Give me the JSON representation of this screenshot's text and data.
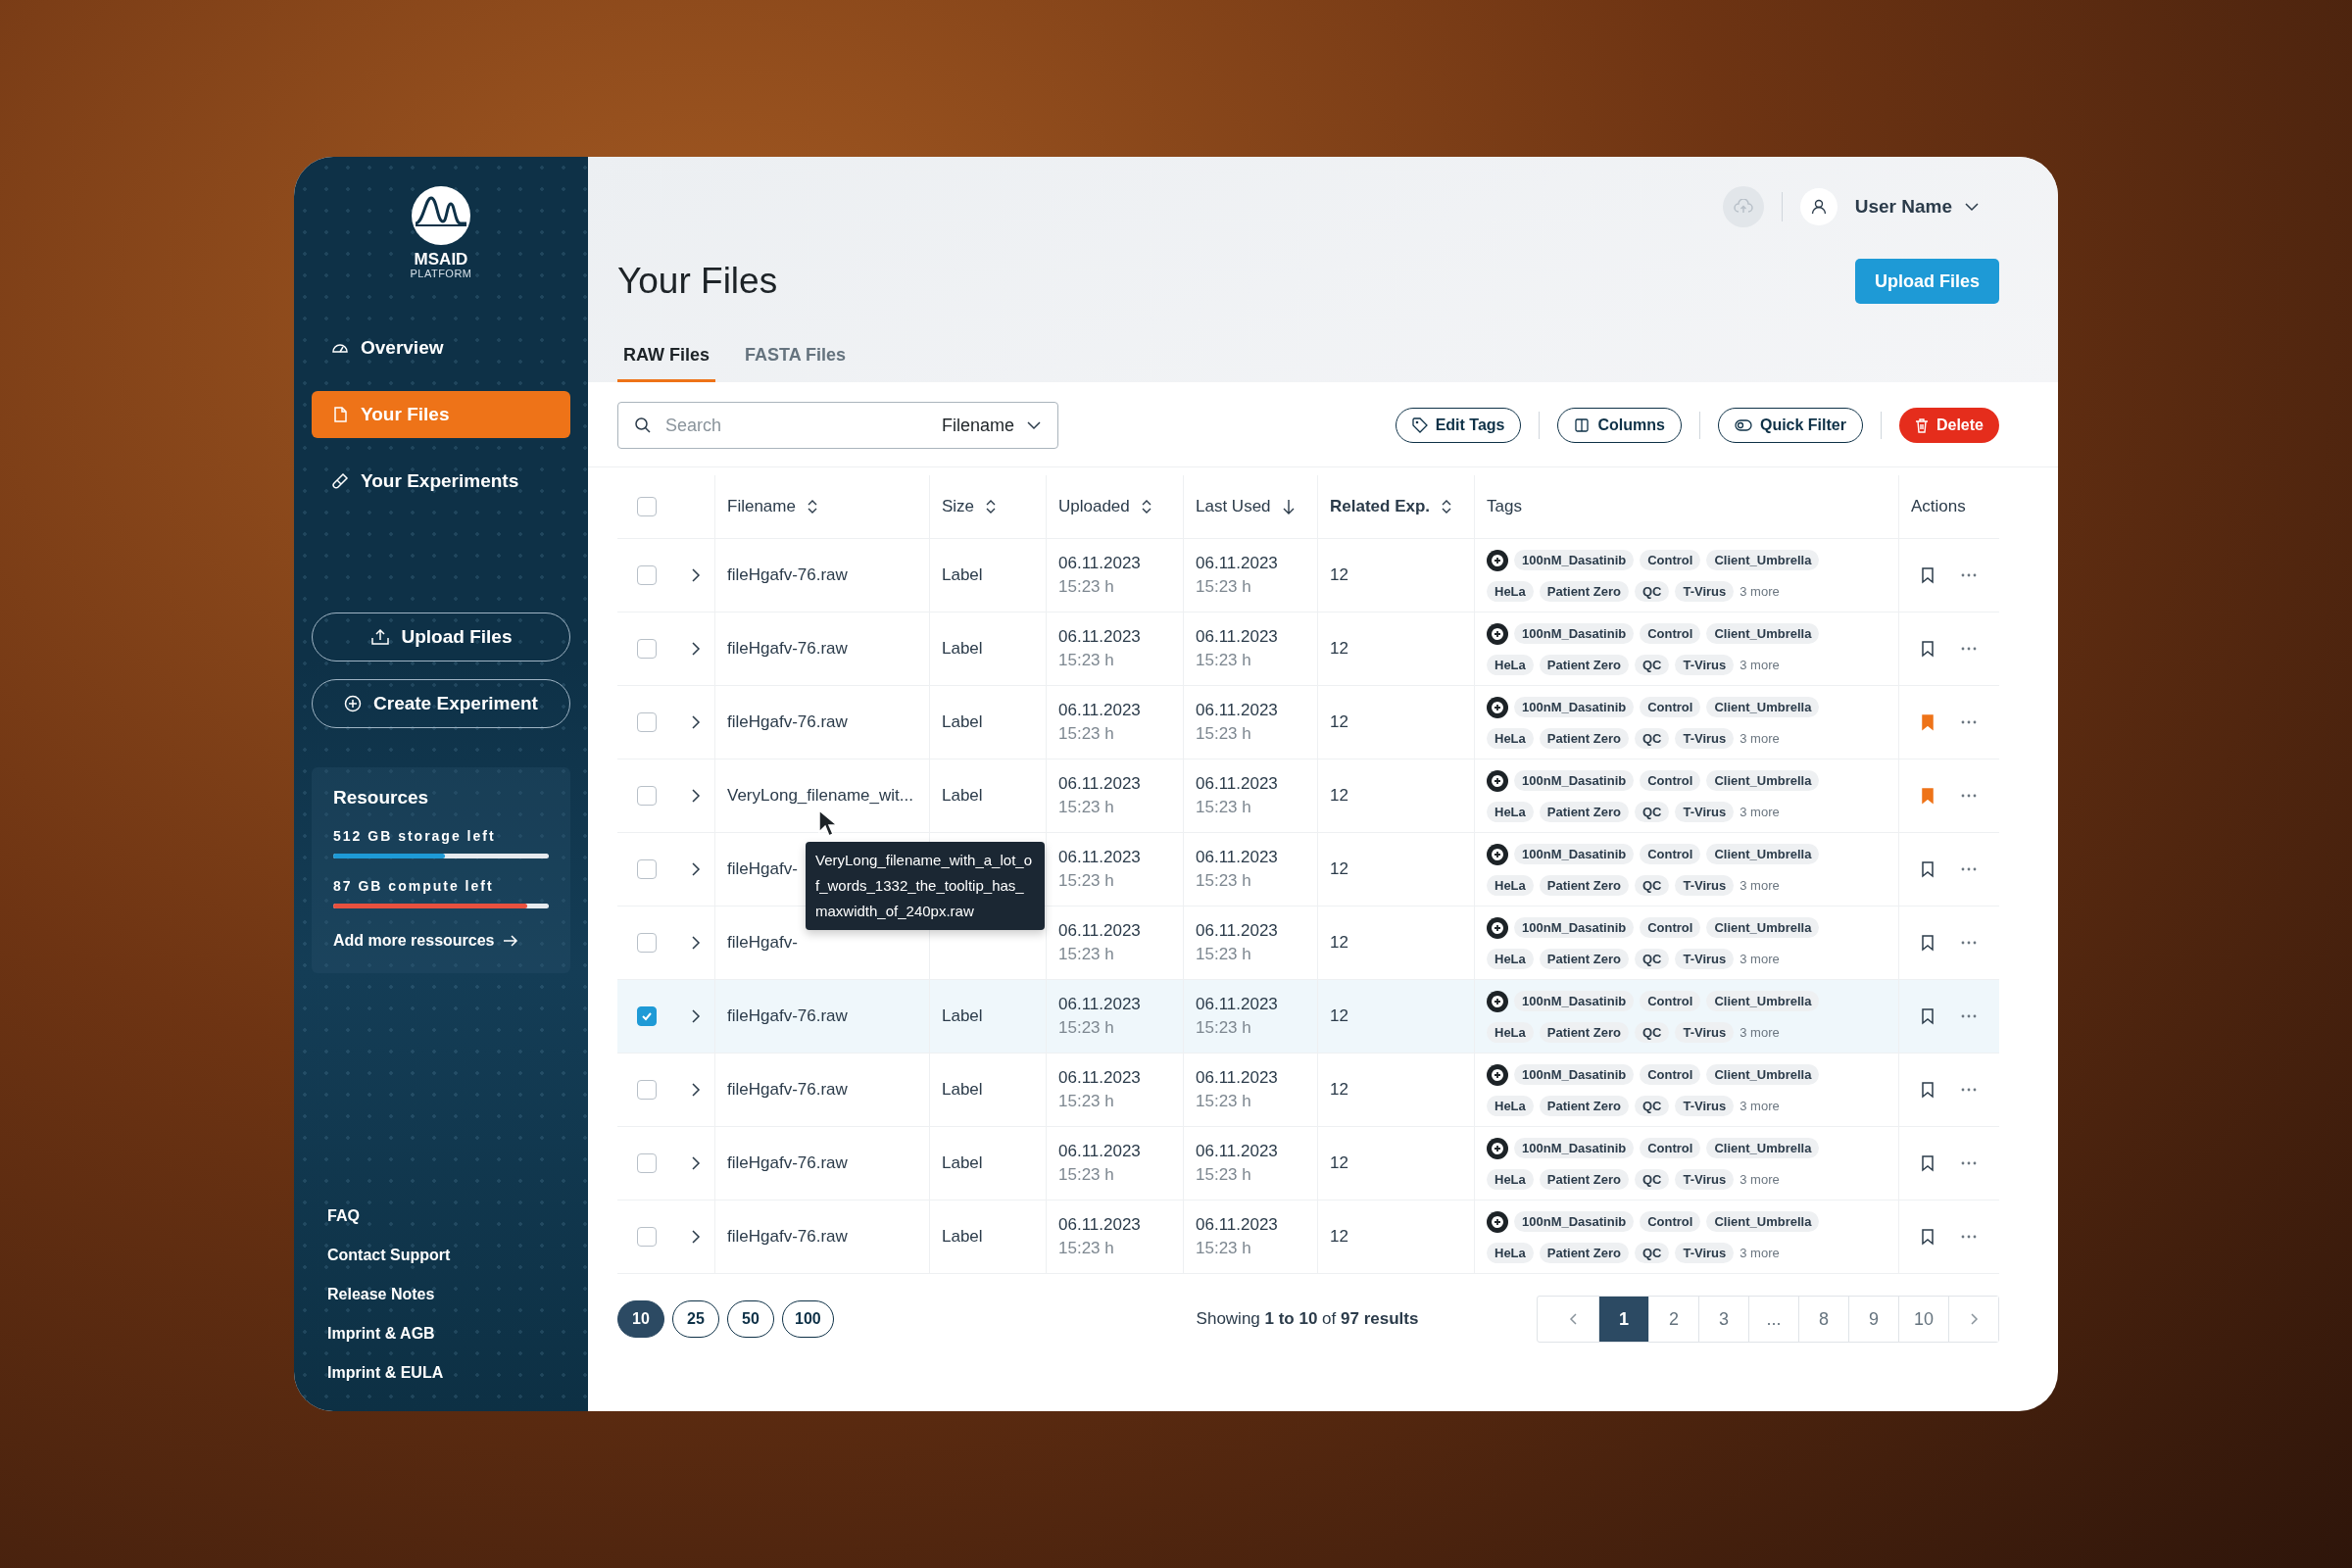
{
  "sidebar": {
    "brand": "MSAID",
    "brand_subtitle": "PLATFORM",
    "nav": [
      {
        "label": "Overview",
        "selected": false
      },
      {
        "label": "Your Files",
        "selected": true
      },
      {
        "label": "Your Experiments",
        "selected": false
      }
    ],
    "actions": [
      "Upload Files",
      "Create Experiment"
    ],
    "resources": {
      "title": "Resources",
      "meters": [
        {
          "label": "512 GB storage left",
          "level": 0.52,
          "color": "#1e9ad6"
        },
        {
          "label": "87 GB compute left",
          "level": 0.9,
          "color": "#e8513f"
        }
      ],
      "link": "Add more ressources"
    },
    "footer_links": [
      "FAQ",
      "Contact Support",
      "Release Notes",
      "Imprint & AGB",
      "Imprint & EULA"
    ]
  },
  "topbar": {
    "user_name": "User Name"
  },
  "page_title": "Your Files",
  "upload_button": "Upload Files",
  "tabs": [
    {
      "label": "RAW Files",
      "selected": true
    },
    {
      "label": "FASTA Files",
      "selected": false
    }
  ],
  "search": {
    "placeholder": "Search",
    "field": "Filename"
  },
  "toolbar": [
    {
      "label": "Edit Tags",
      "kind": "outline"
    },
    {
      "label": "Columns",
      "kind": "outline"
    },
    {
      "label": "Quick Filter",
      "kind": "outline"
    },
    {
      "label": "Delete",
      "kind": "danger"
    }
  ],
  "table": {
    "select_all_checked": false,
    "columns": [
      {
        "label": "Filename",
        "kind": "sortable",
        "bold": false
      },
      {
        "label": "Size",
        "kind": "sortable",
        "bold": false
      },
      {
        "label": "Uploaded",
        "kind": "sortable",
        "bold": false
      },
      {
        "label": "Last Used",
        "kind": "sorted",
        "bold": false
      },
      {
        "label": "Related Exp.",
        "kind": "sortable",
        "bold": true
      },
      {
        "label": "Tags",
        "kind": "plain",
        "bold": false
      },
      {
        "label": "Actions",
        "kind": "plain",
        "bold": false
      }
    ],
    "rows": [
      {
        "checked": false,
        "filename": "fileHgafv-76.raw",
        "size": "Label",
        "uploaded_date": "06.11.2023",
        "uploaded_time": "15:23 h",
        "last_used_date": "06.11.2023",
        "last_used_time": "15:23 h",
        "related": "12",
        "tags": [
          "100nM_Dasatinib",
          "Control",
          "Client_Umbrella",
          "HeLa",
          "Patient Zero",
          "QC",
          "T-Virus"
        ],
        "more": "3 more",
        "bookmarked": false
      },
      {
        "checked": false,
        "filename": "fileHgafv-76.raw",
        "size": "Label",
        "uploaded_date": "06.11.2023",
        "uploaded_time": "15:23 h",
        "last_used_date": "06.11.2023",
        "last_used_time": "15:23 h",
        "related": "12",
        "tags": [
          "100nM_Dasatinib",
          "Control",
          "Client_Umbrella",
          "HeLa",
          "Patient Zero",
          "QC",
          "T-Virus"
        ],
        "more": "3 more",
        "bookmarked": false
      },
      {
        "checked": false,
        "filename": "fileHgafv-76.raw",
        "size": "Label",
        "uploaded_date": "06.11.2023",
        "uploaded_time": "15:23 h",
        "last_used_date": "06.11.2023",
        "last_used_time": "15:23 h",
        "related": "12",
        "tags": [
          "100nM_Dasatinib",
          "Control",
          "Client_Umbrella",
          "HeLa",
          "Patient Zero",
          "QC",
          "T-Virus"
        ],
        "more": "3 more",
        "bookmarked": true
      },
      {
        "checked": false,
        "filename": "VeryLong_filename_wit...",
        "size": "Label",
        "uploaded_date": "06.11.2023",
        "uploaded_time": "15:23 h",
        "last_used_date": "06.11.2023",
        "last_used_time": "15:23 h",
        "related": "12",
        "tags": [
          "100nM_Dasatinib",
          "Control",
          "Client_Umbrella",
          "HeLa",
          "Patient Zero",
          "QC",
          "T-Virus"
        ],
        "more": "3 more",
        "bookmarked": true
      },
      {
        "checked": false,
        "filename": "fileHgafv-",
        "uploaded_date": "06.11.2023",
        "uploaded_time": "15:23 h",
        "last_used_date": "06.11.2023",
        "last_used_time": "15:23 h",
        "related": "12",
        "tags": [
          "100nM_Dasatinib",
          "Control",
          "Client_Umbrella",
          "HeLa",
          "Patient Zero",
          "QC",
          "T-Virus"
        ],
        "more": "3 more",
        "bookmarked": false
      },
      {
        "checked": false,
        "filename": "fileHgafv-",
        "uploaded_date": "06.11.2023",
        "uploaded_time": "15:23 h",
        "last_used_date": "06.11.2023",
        "last_used_time": "15:23 h",
        "related": "12",
        "tags": [
          "100nM_Dasatinib",
          "Control",
          "Client_Umbrella",
          "HeLa",
          "Patient Zero",
          "QC",
          "T-Virus"
        ],
        "more": "3 more",
        "bookmarked": false
      },
      {
        "checked": true,
        "filename": "fileHgafv-76.raw",
        "size": "Label",
        "uploaded_date": "06.11.2023",
        "uploaded_time": "15:23 h",
        "last_used_date": "06.11.2023",
        "last_used_time": "15:23 h",
        "related": "12",
        "tags": [
          "100nM_Dasatinib",
          "Control",
          "Client_Umbrella",
          "HeLa",
          "Patient Zero",
          "QC",
          "T-Virus"
        ],
        "more": "3 more",
        "bookmarked": false
      },
      {
        "checked": false,
        "filename": "fileHgafv-76.raw",
        "size": "Label",
        "uploaded_date": "06.11.2023",
        "uploaded_time": "15:23 h",
        "last_used_date": "06.11.2023",
        "last_used_time": "15:23 h",
        "related": "12",
        "tags": [
          "100nM_Dasatinib",
          "Control",
          "Client_Umbrella",
          "HeLa",
          "Patient Zero",
          "QC",
          "T-Virus"
        ],
        "more": "3 more",
        "bookmarked": false
      },
      {
        "checked": false,
        "filename": "fileHgafv-76.raw",
        "size": "Label",
        "uploaded_date": "06.11.2023",
        "uploaded_time": "15:23 h",
        "last_used_date": "06.11.2023",
        "last_used_time": "15:23 h",
        "related": "12",
        "tags": [
          "100nM_Dasatinib",
          "Control",
          "Client_Umbrella",
          "HeLa",
          "Patient Zero",
          "QC",
          "T-Virus"
        ],
        "more": "3 more",
        "bookmarked": false
      },
      {
        "checked": false,
        "filename": "fileHgafv-76.raw",
        "size": "Label",
        "uploaded_date": "06.11.2023",
        "uploaded_time": "15:23 h",
        "last_used_date": "06.11.2023",
        "last_used_time": "15:23 h",
        "related": "12",
        "tags": [
          "100nM_Dasatinib",
          "Control",
          "Client_Umbrella",
          "HeLa",
          "Patient Zero",
          "QC",
          "T-Virus"
        ],
        "more": "3 more",
        "bookmarked": false
      }
    ],
    "tooltip": "VeryLong_filename_with_a_lot_of_words_1332_the_tooltip_has_maxwidth_of_240px.raw"
  },
  "pagination": {
    "page_sizes": [
      {
        "label": "10",
        "selected": true
      },
      {
        "label": "25",
        "selected": false
      },
      {
        "label": "50",
        "selected": false
      },
      {
        "label": "100",
        "selected": false
      }
    ],
    "summary": "Showing **1 to 10** of **97 results**",
    "pages": [
      {
        "label": "1",
        "selected": true
      },
      {
        "label": "2",
        "selected": false
      },
      {
        "label": "3",
        "selected": false
      },
      {
        "label": "...",
        "selected": false
      },
      {
        "label": "8",
        "selected": false
      },
      {
        "label": "9",
        "selected": false
      },
      {
        "label": "10",
        "selected": false
      }
    ]
  }
}
